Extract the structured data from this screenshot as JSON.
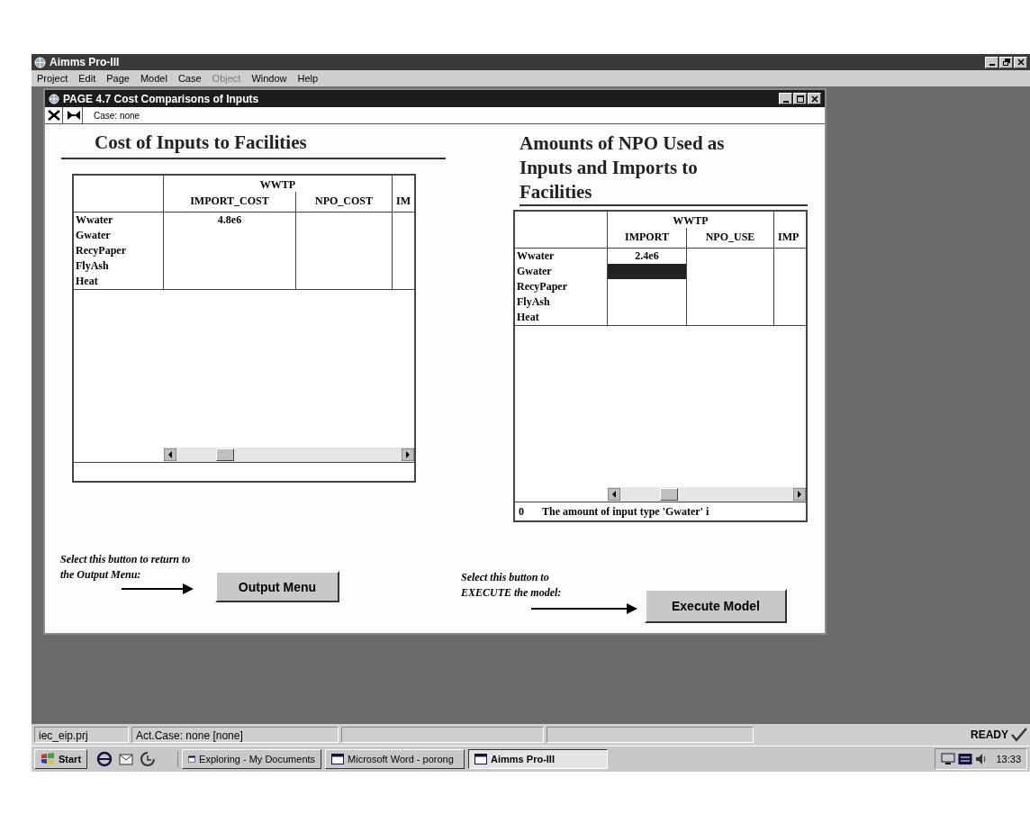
{
  "app": {
    "title": "Aimms Pro-III"
  },
  "menu": [
    {
      "label": "Project",
      "disabled": false
    },
    {
      "label": "Edit",
      "disabled": false
    },
    {
      "label": "Page",
      "disabled": false
    },
    {
      "label": "Model",
      "disabled": false
    },
    {
      "label": "Case",
      "disabled": false
    },
    {
      "label": "Object",
      "disabled": true
    },
    {
      "label": "Window",
      "disabled": false
    },
    {
      "label": "Help",
      "disabled": false
    }
  ],
  "page": {
    "title": "PAGE 4.7   Cost Comparisons of Inputs",
    "case": "Case: none"
  },
  "panels": [
    {
      "heading": "Cost of Inputs to Facilities",
      "table": {
        "group": "WWTP",
        "columns": [
          "IMPORT_COST",
          "NPO_COST",
          "IM"
        ],
        "rows": [
          {
            "name": "Wwater",
            "values": [
              "4.8e6"
            ],
            "selected": false
          },
          {
            "name": "Gwater",
            "selected": false
          },
          {
            "name": "RecyPaper",
            "selected": false
          },
          {
            "name": "FlyAsh",
            "selected": false
          },
          {
            "name": "Heat",
            "selected": false
          }
        ]
      }
    },
    {
      "heading": "Amounts of NPO Used as Inputs and Imports to Facilities",
      "table": {
        "group": "WWTP",
        "columns": [
          "IMPORT",
          "NPO_USE",
          "IMP"
        ],
        "rows": [
          {
            "name": "Wwater",
            "values": [
              "2.4e6"
            ],
            "selected": false
          },
          {
            "name": "Gwater",
            "selected": true
          },
          {
            "name": "RecyPaper",
            "selected": false
          },
          {
            "name": "FlyAsh",
            "selected": false
          },
          {
            "name": "Heat",
            "selected": false
          }
        ],
        "footer": {
          "value": "0",
          "message": "The amount of input type 'Gwater' i"
        }
      }
    }
  ],
  "actions": [
    {
      "hint": "Select this button to return to\nthe Output Menu:",
      "button": "Output Menu"
    },
    {
      "hint": "Select this button to\nEXECUTE the model:",
      "button": "Execute Model"
    }
  ],
  "status_bar": {
    "project": "iec_eip.prj",
    "case": "Act.Case: none  [none]",
    "state": "READY"
  },
  "taskbar": {
    "start": "Start",
    "tasks": [
      {
        "label": "Exploring - My Documents",
        "selected": false
      },
      {
        "label": "Microsoft Word - porong",
        "selected": false
      },
      {
        "label": "Aimms Pro-III",
        "selected": true
      }
    ],
    "clock": "13:33"
  }
}
